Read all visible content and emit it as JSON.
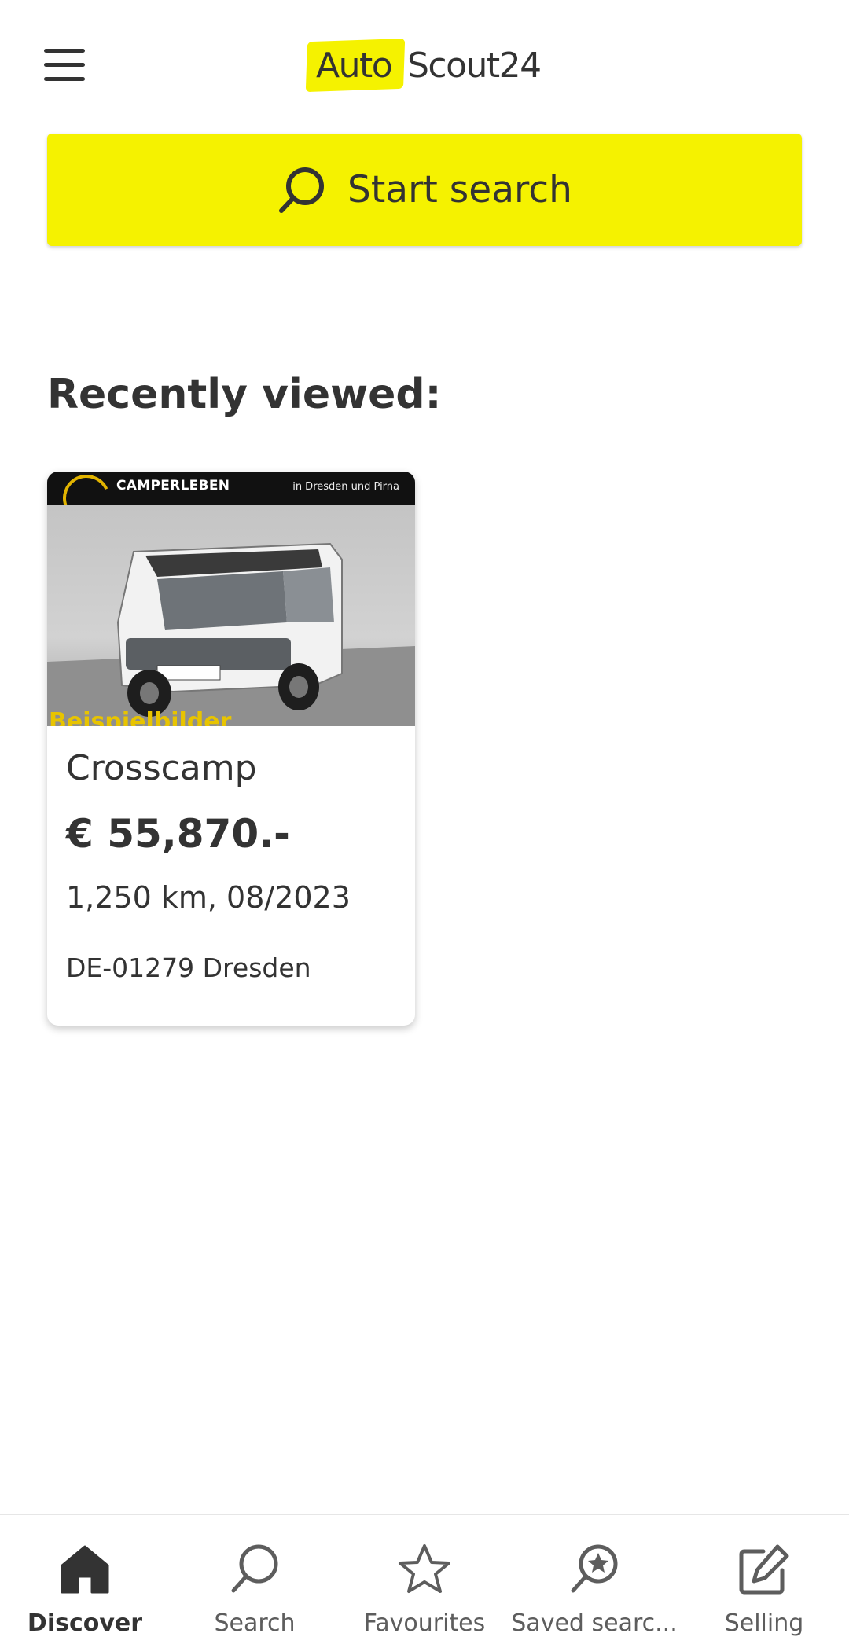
{
  "header": {
    "menu_icon": "hamburger-menu-icon",
    "logo": {
      "part1": "Auto",
      "part2": "Scout24"
    }
  },
  "search_button": {
    "icon": "search-icon",
    "label": "Start search"
  },
  "recently_viewed": {
    "title": "Recently viewed:",
    "items": [
      {
        "image_banner_brand": "CAMPERLEBEN",
        "image_banner_location": "in Dresden und Pirna",
        "image_caption": "Beispielbilder",
        "title": "Crosscamp",
        "price": "€ 55,870.-",
        "details": "1,250 km, 08/2023",
        "location": "DE-01279 Dresden"
      }
    ]
  },
  "bottom_nav": {
    "items": [
      {
        "label": "Discover",
        "icon": "home-icon",
        "active": true
      },
      {
        "label": "Search",
        "icon": "search-icon",
        "active": false
      },
      {
        "label": "Favourites",
        "icon": "star-icon",
        "active": false
      },
      {
        "label": "Saved searc...",
        "icon": "saved-search-icon",
        "active": false
      },
      {
        "label": "Selling",
        "icon": "edit-icon",
        "active": false
      }
    ]
  },
  "colors": {
    "brand_yellow": "#f5f200",
    "text_primary": "#333333",
    "text_secondary": "#5d5d5d"
  }
}
